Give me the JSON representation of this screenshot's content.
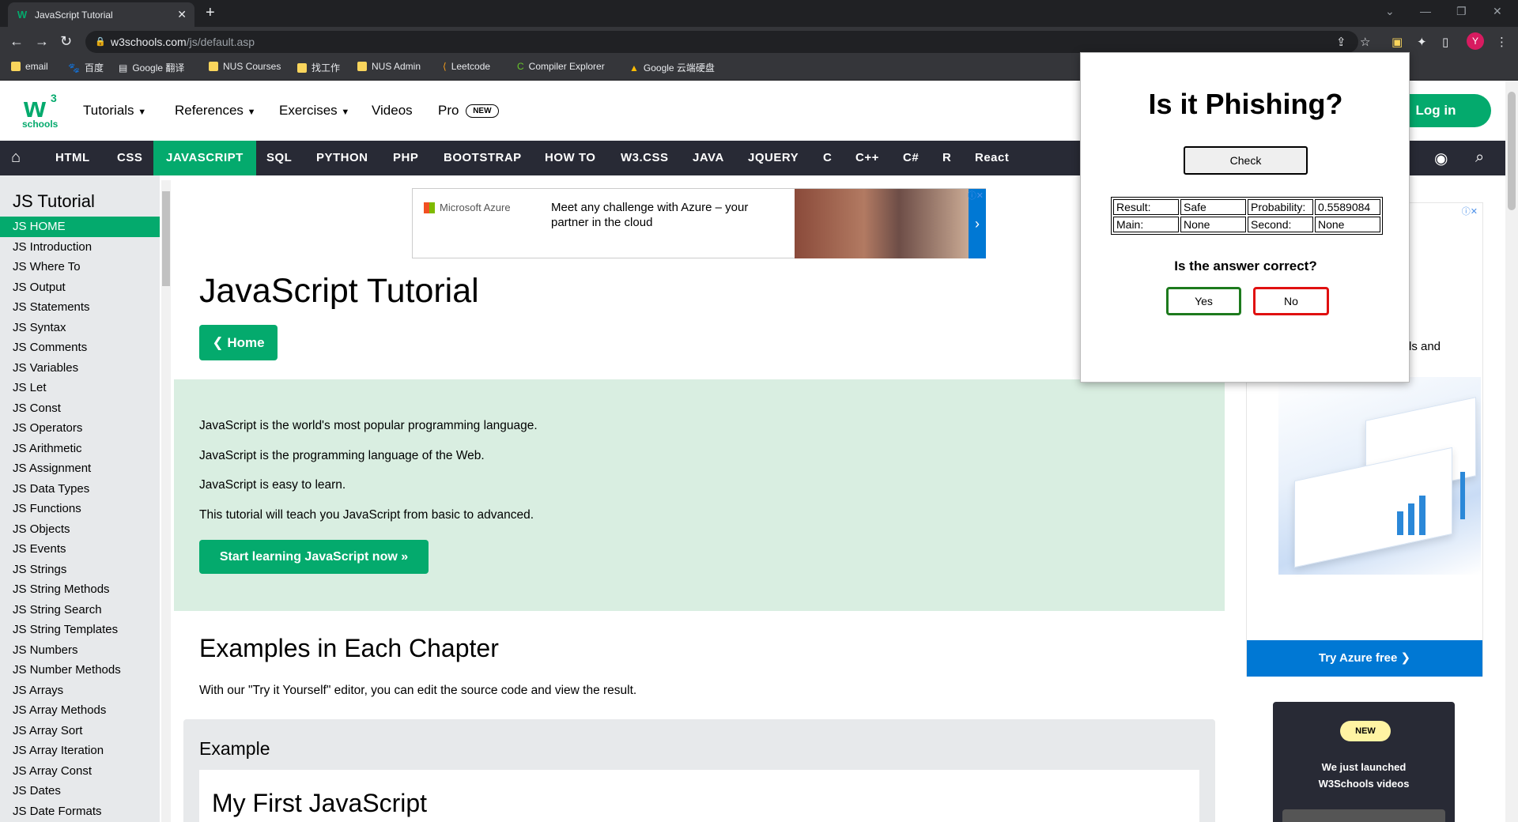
{
  "browser": {
    "tab_title": "JavaScript Tutorial",
    "url_host": "w3schools.com",
    "url_path": "/js/default.asp",
    "avatar_letter": "Y",
    "bookmarks": [
      {
        "label": "email",
        "icon": "folder-icon"
      },
      {
        "label": "百度",
        "icon": "baidu-icon"
      },
      {
        "label": "Google 翻译",
        "icon": "translate-icon"
      },
      {
        "label": "NUS Courses",
        "icon": "folder-icon"
      },
      {
        "label": "找工作",
        "icon": "folder-icon"
      },
      {
        "label": "NUS Admin",
        "icon": "folder-icon"
      },
      {
        "label": "Leetcode",
        "icon": "leetcode-icon"
      },
      {
        "label": "Compiler Explorer",
        "icon": "compiler-explorer-icon"
      },
      {
        "label": "Google 云端硬盘",
        "icon": "google-drive-icon"
      }
    ]
  },
  "header": {
    "logo_text": "schools",
    "logo_sup": "3",
    "menu": [
      "Tutorials",
      "References",
      "Exercises",
      "Videos",
      "Pro"
    ],
    "pro_badge": "NEW",
    "login": "Log in"
  },
  "topnav": [
    "HTML",
    "CSS",
    "JAVASCRIPT",
    "SQL",
    "PYTHON",
    "PHP",
    "BOOTSTRAP",
    "HOW TO",
    "W3.CSS",
    "JAVA",
    "JQUERY",
    "C",
    "C++",
    "C#",
    "R",
    "React"
  ],
  "sidebar": {
    "title": "JS Tutorial",
    "items": [
      "JS HOME",
      "JS Introduction",
      "JS Where To",
      "JS Output",
      "JS Statements",
      "JS Syntax",
      "JS Comments",
      "JS Variables",
      "JS Let",
      "JS Const",
      "JS Operators",
      "JS Arithmetic",
      "JS Assignment",
      "JS Data Types",
      "JS Functions",
      "JS Objects",
      "JS Events",
      "JS Strings",
      "JS String Methods",
      "JS String Search",
      "JS String Templates",
      "JS Numbers",
      "JS Number Methods",
      "JS Arrays",
      "JS Array Methods",
      "JS Array Sort",
      "JS Array Iteration",
      "JS Array Const",
      "JS Dates",
      "JS Date Formats"
    ]
  },
  "ad_top": {
    "brand": "Microsoft Azure",
    "copy": "Meet any challenge with Azure – your partner in the cloud"
  },
  "main": {
    "title": "JavaScript Tutorial",
    "home_button": "❮ Home",
    "intro": [
      "JavaScript is the world's most popular programming language.",
      "JavaScript is the programming language of the Web.",
      "JavaScript is easy to learn.",
      "This tutorial will teach you JavaScript from basic to advanced."
    ],
    "start_button": "Start learning JavaScript now »",
    "examples_heading": "Examples in Each Chapter",
    "examples_text": "With our \"Try it Yourself\" editor, you can edit the source code and view the result.",
    "example_label": "Example",
    "example_code_title": "My First JavaScript"
  },
  "right_ad": {
    "fragment": "ls and",
    "try_button": "Try Azure free ❯"
  },
  "video_card": {
    "badge": "NEW",
    "text_line1": "We just launched",
    "text_line2": "W3Schools videos"
  },
  "phishing_popup": {
    "title": "Is it Phishing?",
    "check_button": "Check",
    "result_label": "Result:",
    "result_value": "Safe",
    "probability_label": "Probability:",
    "probability_value": "0.5589084",
    "main_label": "Main:",
    "main_value": "None",
    "second_label": "Second:",
    "second_value": "None",
    "question": "Is the answer correct?",
    "yes": "Yes",
    "no": "No"
  },
  "colors": {
    "w3_green": "#04aa6d",
    "nav_dark": "#282a35",
    "sidebar_bg": "#e7e9eb",
    "intro_bg": "#d9eee1",
    "azure_blue": "#0078d4"
  }
}
